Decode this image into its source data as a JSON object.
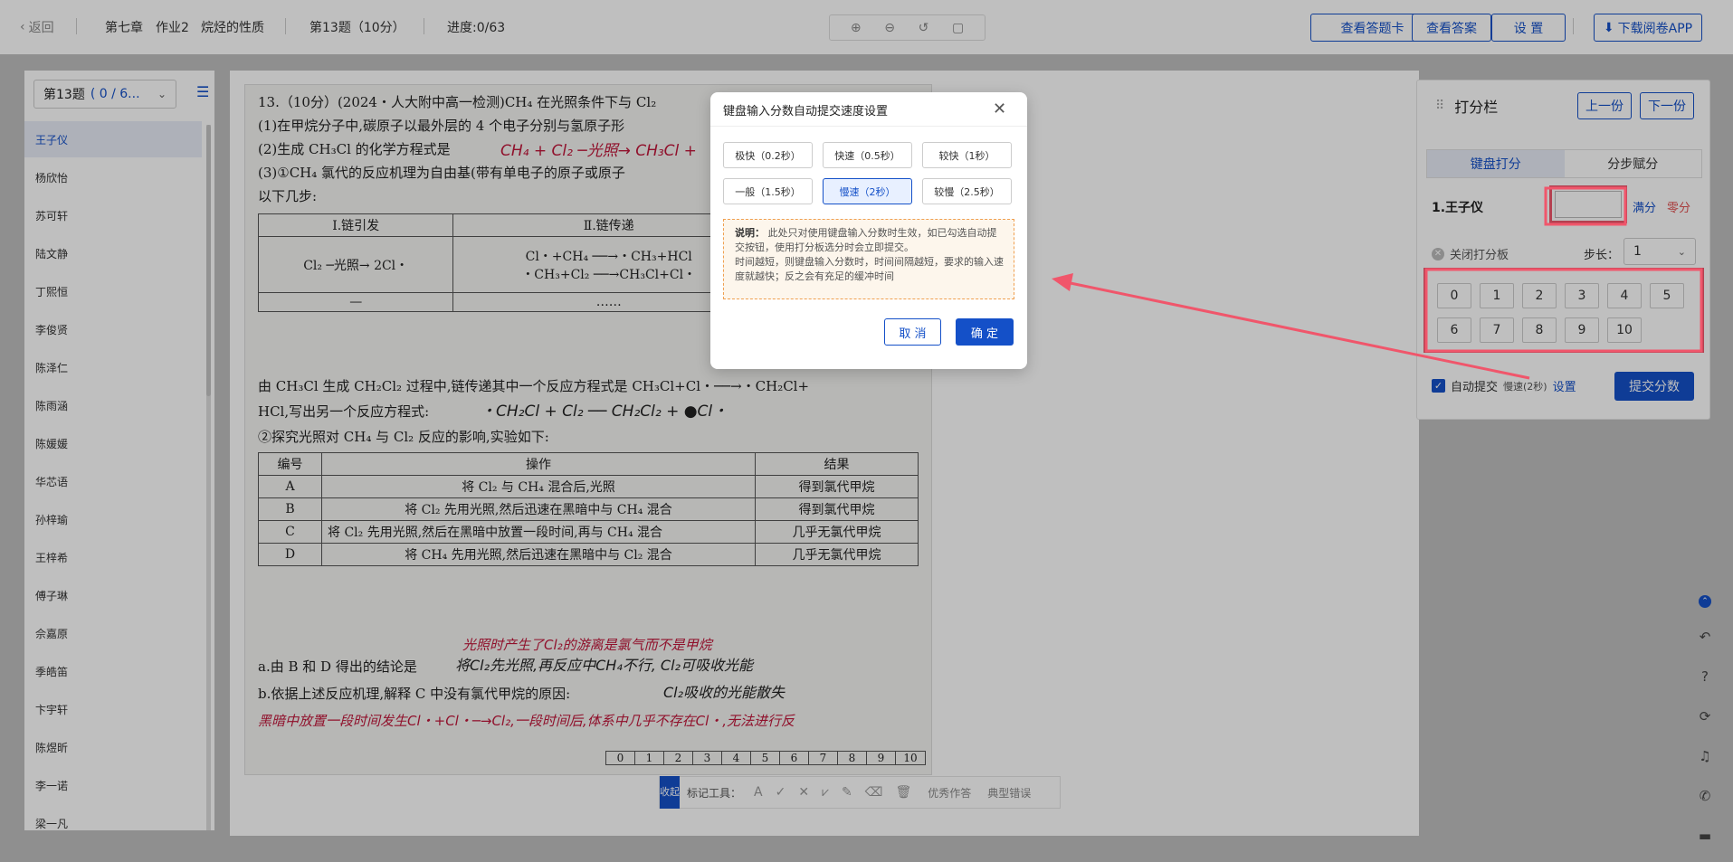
{
  "topbar": {
    "back_label": "返回",
    "chapter": "第七章",
    "assignment": "作业2",
    "topic": "烷烃的性质",
    "question": "第13题（10分）",
    "progress": "进度:0/63",
    "view_answer_card": "查看答题卡",
    "view_answer": "查看答案",
    "settings": "设 置",
    "download_app": "下载阅卷APP"
  },
  "sidebar": {
    "question_select": "第13题",
    "question_progress": "( 0 / 6...",
    "students": [
      "王子仪",
      "杨欣怡",
      "苏可轩",
      "陆文静",
      "丁熙恒",
      "李俊贤",
      "陈泽仁",
      "陈雨涵",
      "陈媛媛",
      "华芯语",
      "孙梓瑜",
      "王梓希",
      "傅子琳",
      "佘嘉原",
      "季皓笛",
      "卞宇轩",
      "陈煜昕",
      "李一诺",
      "梁一凡"
    ]
  },
  "paper": {
    "lines": [
      "13.（10分）(2024・人大附中高一检测)CH₄ 在光照条件下与 Cl₂",
      "(1)在甲烷分子中,碳原子以最外层的 4 个电子分别与氢原子形",
      "(2)生成 CH₃Cl 的化学方程式是",
      "(3)①CH₄ 氯代的反应机理为自由基(带有单电子的原子或原子",
      "以下几步:",
      "由 CH₃Cl 生成 CH₂Cl₂ 过程中,链传递其中一个反应方程式是 CH₃Cl+Cl・──→・CH₂Cl+",
      "HCl,写出另一个反应方程式:",
      "②探究光照对 CH₄ 与 Cl₂ 反应的影响,实验如下:",
      "a.由 B 和 D 得出的结论是",
      "b.依据上述反应机理,解释 C 中没有氯代甲烷的原因:"
    ],
    "handwriting": {
      "eq1": "CH₄ + Cl₂ ─光照→ CH₃Cl +",
      "eq2": "・CH₂Cl + Cl₂ ── CH₂Cl₂ + ●Cl・",
      "ans_a": "将Cl₂先光照,再反应中CH₄不行, Cl₂可吸收光能",
      "ans_a_top": "光照时产生了Cl₂的游离是氯气而不是甲烷",
      "ans_b": "Cl₂吸收的光能散失",
      "ans_b2": "黑暗中放置一段时间发生Cl・+Cl・─→Cl₂,一段时间后,体系中几乎不存在Cl・,无法进行反"
    },
    "table1": {
      "headers": [
        "Ⅰ.链引发",
        "Ⅱ.链传递"
      ],
      "row1": [
        "Cl₂ ─光照→ 2Cl・",
        "Cl・+CH₄ ──→・CH₃+HCl"
      ],
      "row1b": "・CH₃+Cl₂ ──→CH₃Cl+Cl・",
      "row2": [
        "—",
        "……"
      ]
    },
    "table2": {
      "headers": [
        "编号",
        "操作",
        "结果"
      ],
      "rows": [
        [
          "A",
          "将 Cl₂ 与 CH₄ 混合后,光照",
          "得到氯代甲烷"
        ],
        [
          "B",
          "将 Cl₂ 先用光照,然后迅速在黑暗中与 CH₄ 混合",
          "得到氯代甲烷"
        ],
        [
          "C",
          "将 Cl₂ 先用光照,然后在黑暗中放置一段时间,再与 CH₄ 混合",
          "几乎无氯代甲烷"
        ],
        [
          "D",
          "将 CH₄ 先用光照,然后迅速在黑暗中与 Cl₂ 混合",
          "几乎无氯代甲烷"
        ]
      ]
    },
    "scorebar": [
      "0",
      "1",
      "2",
      "3",
      "4",
      "5",
      "6",
      "7",
      "8",
      "9",
      "10"
    ]
  },
  "marktools": {
    "collapse": "收起",
    "label": "标记工具：",
    "excellent": "优秀作答",
    "typical_error": "典型错误"
  },
  "scorepanel": {
    "title": "打分栏",
    "prev": "上一份",
    "next": "下一份",
    "tab_keyboard": "键盘打分",
    "tab_step": "分步赋分",
    "student_name": "1.王子仪",
    "score_value": "",
    "full": "满分",
    "zero": "零分",
    "close_board": "关闭打分板",
    "step_label": "步长：",
    "step_value": "1",
    "keys": [
      "0",
      "1",
      "2",
      "3",
      "4",
      "5",
      "6",
      "7",
      "8",
      "9",
      "10"
    ],
    "auto_submit": "自动提交",
    "auto_speed": "慢速(2秒)",
    "auto_setting": "设置",
    "submit": "提交分数"
  },
  "dialog": {
    "title": "键盘输入分数自动提交速度设置",
    "options": [
      "极快（0.2秒）",
      "快速（0.5秒）",
      "较快（1秒）",
      "一般（1.5秒）",
      "慢速（2秒）",
      "较慢（2.5秒）"
    ],
    "selected_index": 4,
    "note_label": "说明：",
    "note_text": "此处只对使用键盘输入分数时生效，如已勾选自动提交按钮，使用打分板选分时会立即提交。",
    "note_text2": "时间越短，则键盘输入分数时，时间间隔越短，要求的输入速度就越快；反之会有充足的缓冲时间",
    "cancel": "取 消",
    "ok": "确 定"
  },
  "colors": {
    "accent": "#1450c8",
    "highlight": "#f0566b",
    "handwriting": "#c0163a"
  }
}
